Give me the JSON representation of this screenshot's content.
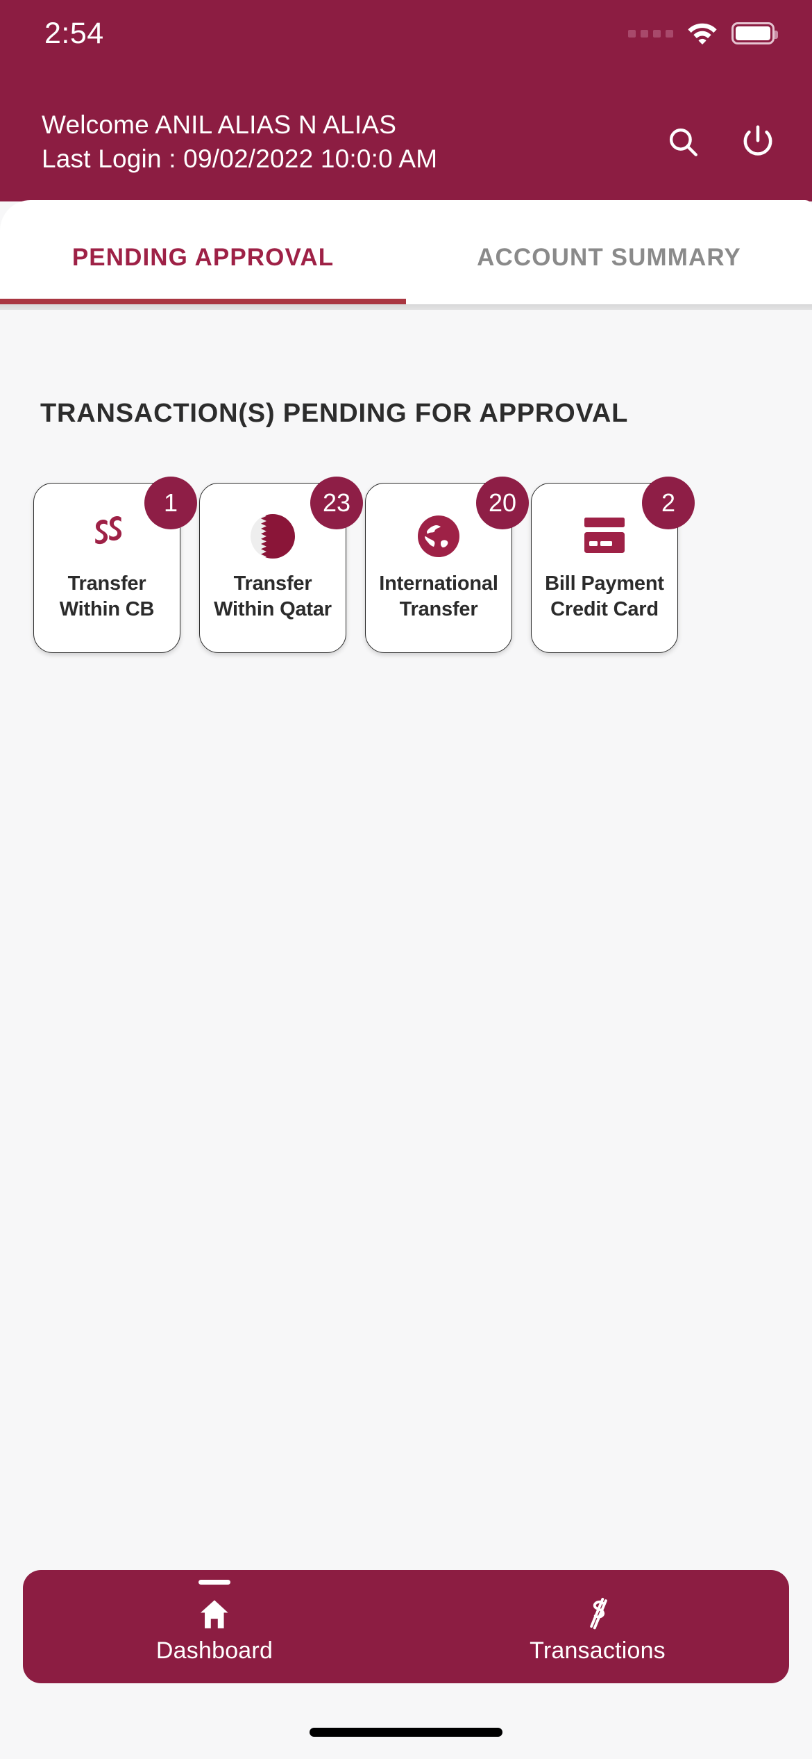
{
  "status_bar": {
    "time": "2:54",
    "signal_icon": "signal-dots-icon",
    "wifi_icon": "wifi-icon",
    "battery_icon": "battery-full-icon"
  },
  "header": {
    "welcome_text": "Welcome ANIL ALIAS N ALIAS",
    "last_login_text": "Last Login : 09/02/2022 10:0:0 AM",
    "search_icon": "search-icon",
    "logout_icon": "power-icon",
    "background_color": "#8c1d42"
  },
  "tabs": [
    {
      "label": "PENDING APPROVAL",
      "active": true
    },
    {
      "label": "ACCOUNT SUMMARY",
      "active": false
    }
  ],
  "main": {
    "section_title": "TRANSACTION(S) PENDING FOR APPROVAL",
    "tiles": [
      {
        "label": "Transfer\nWithin CB",
        "badge": "1",
        "icon": "double-swirl-logo-icon"
      },
      {
        "label": "Transfer\nWithin Qatar",
        "badge": "23",
        "icon": "qatar-flag-icon"
      },
      {
        "label": "International\nTransfer",
        "badge": "20",
        "icon": "globe-icon"
      },
      {
        "label": "Bill Payment\nCredit Card",
        "badge": "2",
        "icon": "credit-card-icon"
      }
    ]
  },
  "bottom_nav": [
    {
      "label": "Dashboard",
      "icon": "home-icon",
      "active": true
    },
    {
      "label": "Transactions",
      "icon": "money-exchange-icon",
      "active": false
    }
  ],
  "colors": {
    "brand_maroon": "#8c1d42",
    "badge_maroon": "#8e1e46",
    "tab_active": "#9e2146",
    "tab_inactive": "#8a8a8a",
    "tab_underline": "#a93641",
    "page_bg": "#f7f7f8"
  }
}
